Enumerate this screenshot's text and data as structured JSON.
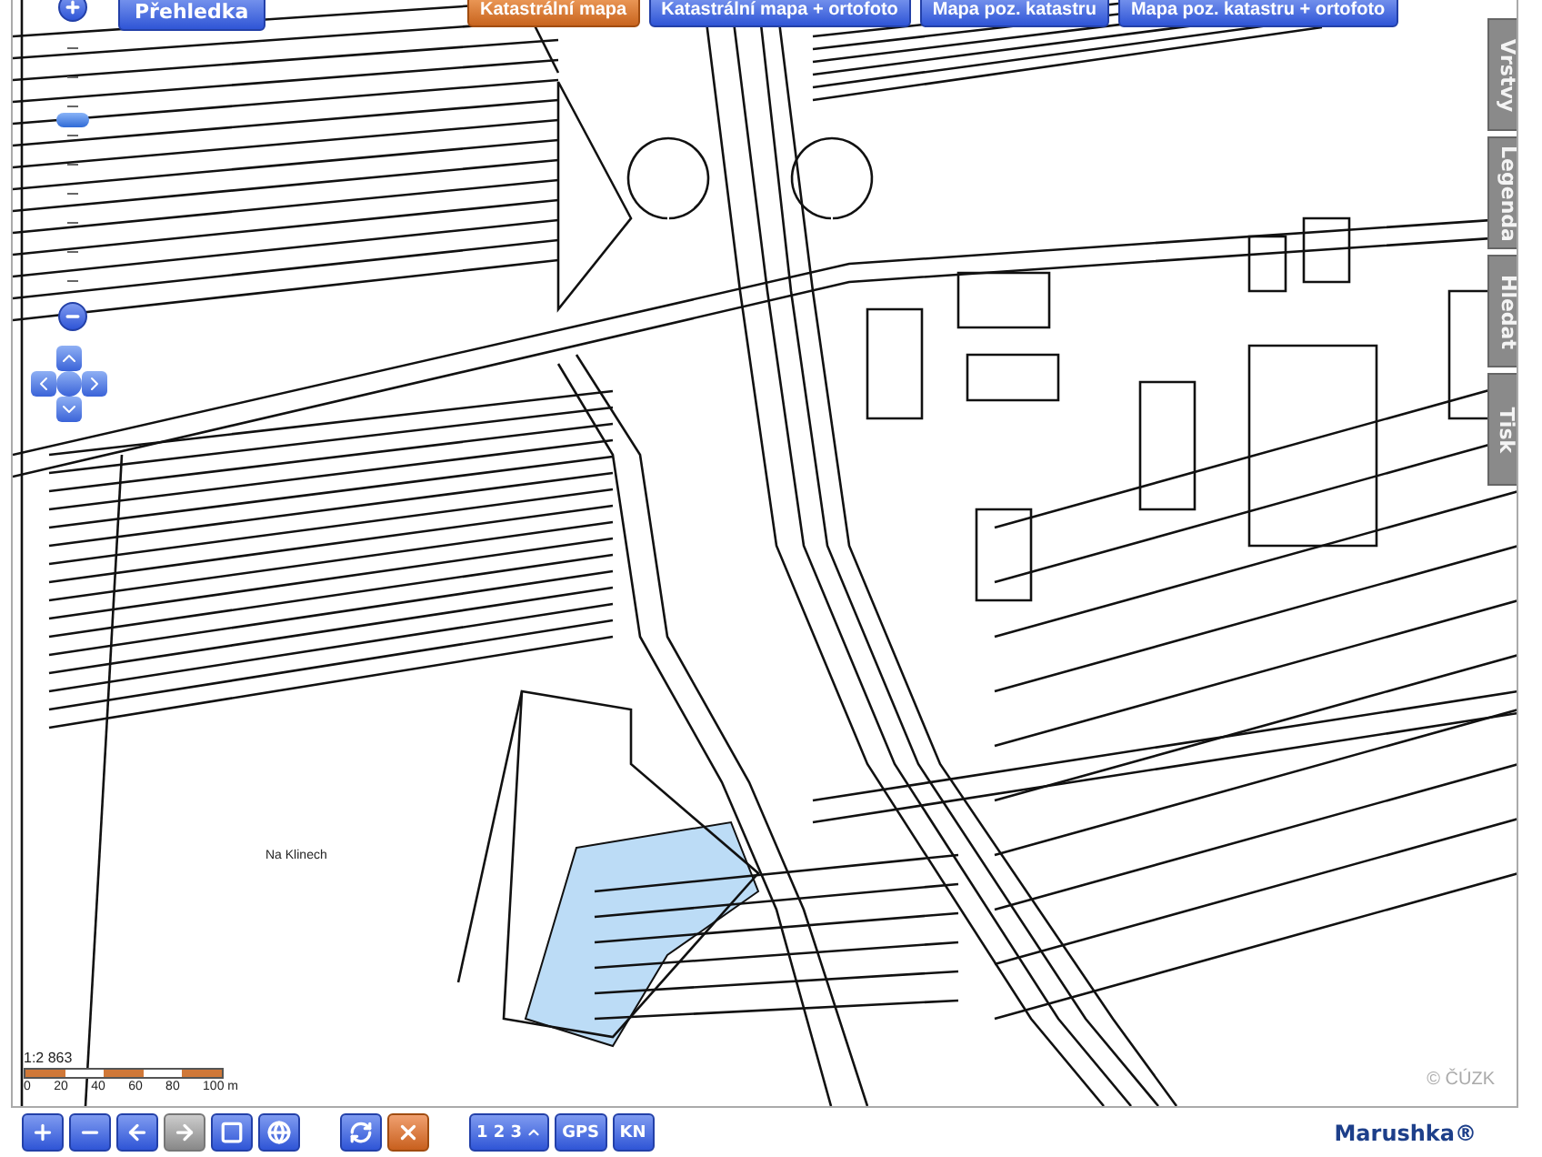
{
  "overview_button": "Přehledka",
  "map_layers": [
    {
      "label": "Katastrální mapa",
      "selected": true
    },
    {
      "label": "Katastrální mapa + ortofoto",
      "selected": false
    },
    {
      "label": "Mapa poz. katastru",
      "selected": false
    },
    {
      "label": "Mapa poz. katastru + ortofoto",
      "selected": false
    }
  ],
  "zoom": {
    "level": 0.66
  },
  "side_tabs": [
    {
      "label": "Vrstvy"
    },
    {
      "label": "Legenda"
    },
    {
      "label": "Hledat"
    },
    {
      "label": "Tisk"
    }
  ],
  "map": {
    "place_label": "Na Klinech",
    "copyright": "© ČÚZK"
  },
  "scale": {
    "ratio": "1:2 863",
    "ticks": [
      "0",
      "20",
      "40",
      "60",
      "80",
      "100 m"
    ]
  },
  "toolbar": [
    {
      "kind": "zoom-in",
      "disabled": false
    },
    {
      "kind": "zoom-out",
      "disabled": false
    },
    {
      "kind": "back",
      "disabled": false
    },
    {
      "kind": "forward",
      "disabled": true
    },
    {
      "kind": "zoom-box",
      "disabled": false
    },
    {
      "kind": "globe",
      "disabled": false
    },
    {
      "kind": "gap"
    },
    {
      "kind": "refresh",
      "disabled": false
    },
    {
      "kind": "clear",
      "disabled": false
    },
    {
      "kind": "gap"
    },
    {
      "kind": "measure",
      "label": "1 2 3",
      "disabled": false
    },
    {
      "kind": "text",
      "label": "GPS",
      "disabled": false
    },
    {
      "kind": "text",
      "label": "KN",
      "disabled": false
    }
  ],
  "brand": "Marushka®"
}
